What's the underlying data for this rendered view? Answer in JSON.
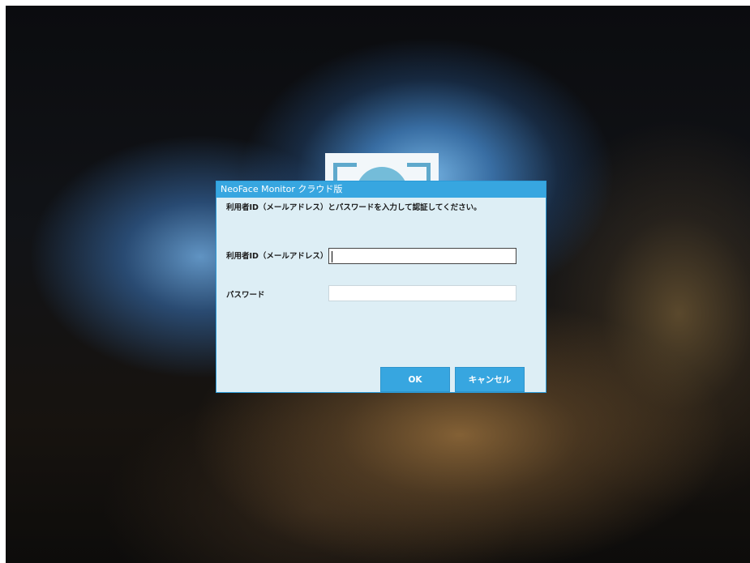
{
  "dialog": {
    "title": "NeoFace Monitor クラウド版",
    "instruction": "利用者ID（メールアドレス）とパスワードを入力して認証してください。",
    "user_id_label": "利用者ID（メールアドレス）",
    "user_id_value": "",
    "password_label": "パスワード",
    "password_value": "",
    "ok_label": "OK",
    "cancel_label": "キャンセル"
  },
  "colors": {
    "titlebar": "#37a6e0",
    "dialog_background": "#ddeef5",
    "button": "#37a6e0",
    "logo_accent": "#5fa9cc"
  },
  "icons": {
    "app_logo": "face-recognition-logo-icon"
  }
}
